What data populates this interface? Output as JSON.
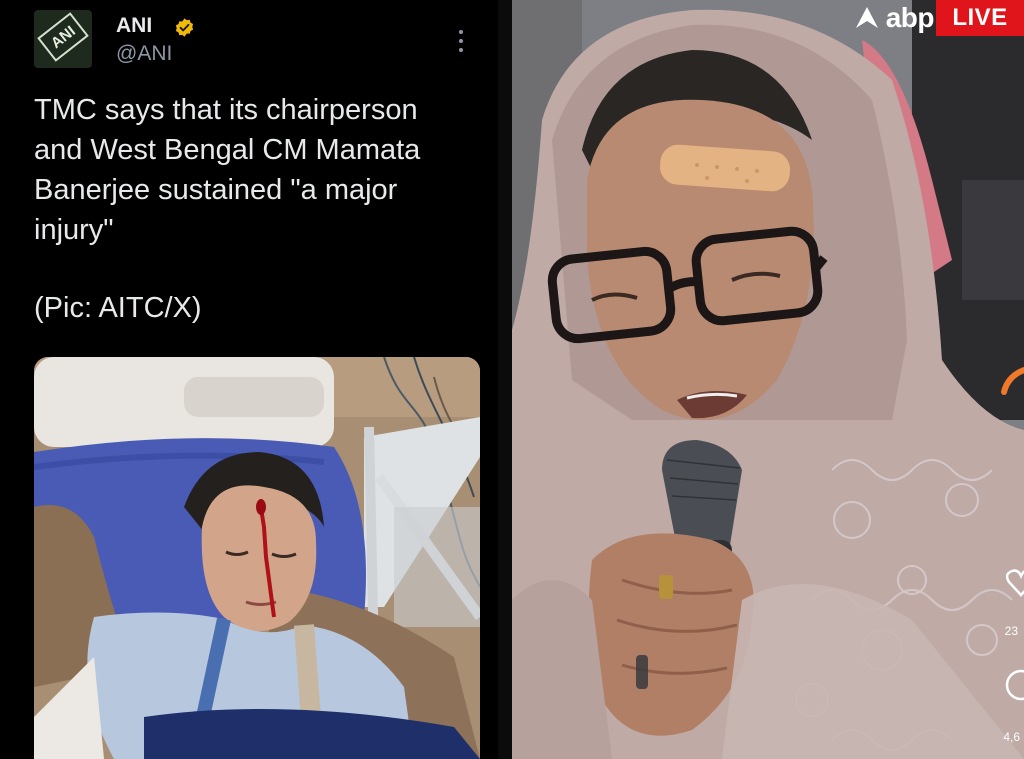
{
  "tweet": {
    "author_name": "ANI",
    "author_handle": "@ANI",
    "avatar_text": "ANI",
    "text_lines": [
      "TMC says that its chairperson",
      "and West Bengal CM Mamata",
      "Banerjee sustained \"a major",
      "injury\""
    ],
    "photo_credit": "(Pic: AITC/X)",
    "photo_description_icon": "hospital-photo"
  },
  "video": {
    "channel_logo": "abp",
    "live_label": "LIVE",
    "like_count": "23",
    "comment_count": "4,6"
  },
  "colors": {
    "background": "#000000",
    "text_primary": "#e7e9ea",
    "text_secondary": "#8b98a5",
    "verified_badge": "#f0b90b",
    "live_red": "#e0141b"
  }
}
